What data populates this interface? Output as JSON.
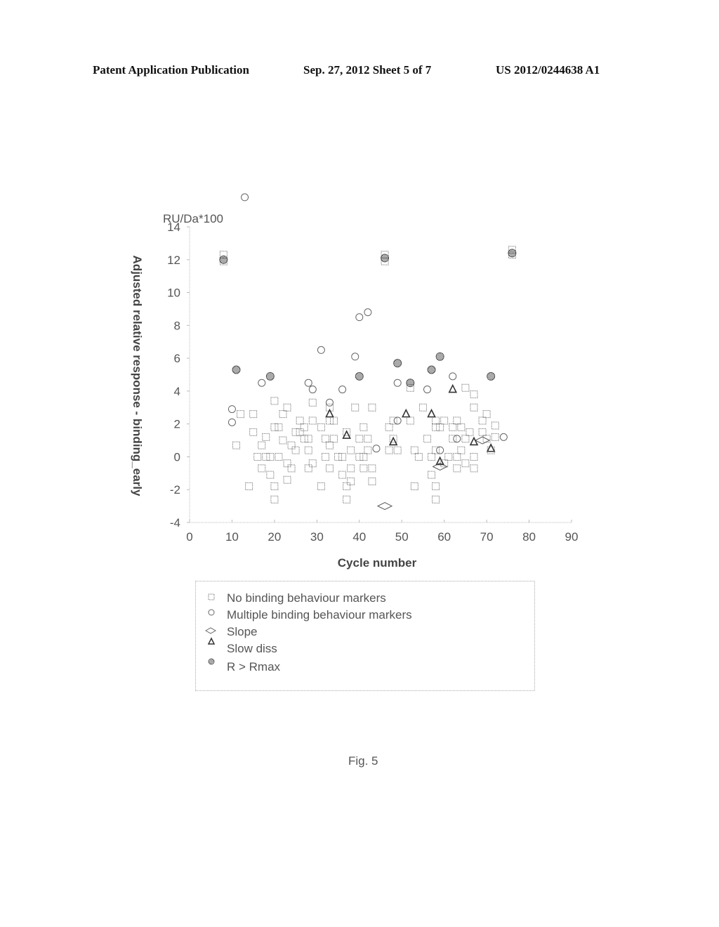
{
  "header": {
    "left": "Patent Application Publication",
    "middle": "Sep. 27, 2012   Sheet 5 of 7",
    "right": "US 2012/0244638 A1"
  },
  "figure_caption": "Fig. 5",
  "chart_data": {
    "type": "scatter",
    "title": "",
    "xlabel": "Cycle number",
    "ylabel": "Adjusted relative response - binding_early",
    "y_unit_label": "RU/Da*100",
    "xlim": [
      0,
      90
    ],
    "ylim": [
      -4,
      14
    ],
    "x_ticks": [
      0,
      10,
      20,
      30,
      40,
      50,
      60,
      70,
      80,
      90
    ],
    "y_ticks": [
      -4,
      -2,
      0,
      2,
      4,
      6,
      8,
      10,
      12,
      14
    ],
    "grid": false,
    "legend_position": "bottom",
    "series": [
      {
        "name": "No binding behaviour markers",
        "marker": "square",
        "points": [
          [
            8,
            12.3
          ],
          [
            8,
            11.9
          ],
          [
            11,
            0.7
          ],
          [
            12,
            2.6
          ],
          [
            14,
            -1.8
          ],
          [
            15,
            2.6
          ],
          [
            15,
            1.5
          ],
          [
            16,
            0
          ],
          [
            17,
            0.7
          ],
          [
            17,
            -0.7
          ],
          [
            18,
            1.2
          ],
          [
            18,
            0
          ],
          [
            19,
            0
          ],
          [
            19,
            -1.1
          ],
          [
            20,
            3.4
          ],
          [
            20,
            1.8
          ],
          [
            20,
            -1.8
          ],
          [
            20,
            -2.6
          ],
          [
            21,
            1.8
          ],
          [
            21,
            0
          ],
          [
            22,
            2.6
          ],
          [
            22,
            1
          ],
          [
            23,
            3
          ],
          [
            23,
            -0.4
          ],
          [
            23,
            -1.4
          ],
          [
            24,
            0.7
          ],
          [
            24,
            -0.7
          ],
          [
            25,
            1.5
          ],
          [
            25,
            0.4
          ],
          [
            26,
            2.2
          ],
          [
            26,
            1.5
          ],
          [
            27,
            1.8
          ],
          [
            27,
            1.1
          ],
          [
            28,
            1.1
          ],
          [
            28,
            0.4
          ],
          [
            28,
            -0.7
          ],
          [
            29,
            3.3
          ],
          [
            29,
            2.2
          ],
          [
            29,
            -0.4
          ],
          [
            31,
            1.8
          ],
          [
            31,
            -1.8
          ],
          [
            32,
            1.1
          ],
          [
            32,
            0
          ],
          [
            33,
            3
          ],
          [
            33,
            2.2
          ],
          [
            33,
            0.7
          ],
          [
            33,
            -0.7
          ],
          [
            34,
            2.2
          ],
          [
            34,
            1.1
          ],
          [
            35,
            0
          ],
          [
            36,
            0
          ],
          [
            36,
            -1.1
          ],
          [
            37,
            1.5
          ],
          [
            37,
            -1.8
          ],
          [
            37,
            -2.6
          ],
          [
            38,
            0.4
          ],
          [
            38,
            -0.7
          ],
          [
            38,
            -1.5
          ],
          [
            39,
            3
          ],
          [
            40,
            1.1
          ],
          [
            40,
            0
          ],
          [
            41,
            1.8
          ],
          [
            41,
            0
          ],
          [
            41,
            -0.7
          ],
          [
            42,
            1.1
          ],
          [
            42,
            0.4
          ],
          [
            43,
            3
          ],
          [
            43,
            -0.7
          ],
          [
            43,
            -1.5
          ],
          [
            46,
            12.3
          ],
          [
            46,
            11.9
          ],
          [
            47,
            1.8
          ],
          [
            47,
            0.4
          ],
          [
            48,
            2.2
          ],
          [
            48,
            1.1
          ],
          [
            49,
            0.4
          ],
          [
            52,
            2.2
          ],
          [
            52,
            4.2
          ],
          [
            53,
            -1.8
          ],
          [
            53,
            0.4
          ],
          [
            54,
            0
          ],
          [
            55,
            3
          ],
          [
            56,
            1.1
          ],
          [
            57,
            0
          ],
          [
            57,
            -1.1
          ],
          [
            58,
            2.2
          ],
          [
            58,
            1.8
          ],
          [
            58,
            0.4
          ],
          [
            58,
            -1.8
          ],
          [
            58,
            -2.6
          ],
          [
            59,
            1.8
          ],
          [
            60,
            2.2
          ],
          [
            60,
            -0.4
          ],
          [
            61,
            0
          ],
          [
            62,
            1.8
          ],
          [
            62,
            1.1
          ],
          [
            63,
            2.2
          ],
          [
            63,
            0
          ],
          [
            63,
            -0.7
          ],
          [
            64,
            1.8
          ],
          [
            64,
            0.4
          ],
          [
            65,
            4.2
          ],
          [
            65,
            1.1
          ],
          [
            65,
            -0.4
          ],
          [
            66,
            1.5
          ],
          [
            67,
            3.8
          ],
          [
            67,
            3
          ],
          [
            67,
            0
          ],
          [
            67,
            -0.7
          ],
          [
            69,
            1.5
          ],
          [
            69,
            2.2
          ],
          [
            70,
            2.6
          ],
          [
            70,
            1.1
          ],
          [
            71,
            0.4
          ],
          [
            72,
            1.9
          ],
          [
            72,
            1.2
          ],
          [
            76,
            12.6
          ],
          [
            76,
            12.3
          ]
        ]
      },
      {
        "name": "Multiple binding behaviour markers",
        "marker": "circle",
        "points": [
          [
            13,
            15.8
          ],
          [
            10,
            2.9
          ],
          [
            10,
            2.1
          ],
          [
            17,
            4.5
          ],
          [
            28,
            4.5
          ],
          [
            29,
            4.1
          ],
          [
            31,
            6.5
          ],
          [
            33,
            3.3
          ],
          [
            36,
            4.1
          ],
          [
            39,
            6.1
          ],
          [
            40,
            8.5
          ],
          [
            42,
            8.8
          ],
          [
            44,
            0.5
          ],
          [
            49,
            4.5
          ],
          [
            49,
            2.2
          ],
          [
            56,
            4.1
          ],
          [
            59,
            0.4
          ],
          [
            62,
            4.9
          ],
          [
            63,
            1.1
          ],
          [
            74,
            1.2
          ]
        ]
      },
      {
        "name": "Slope",
        "marker": "diamond",
        "points": [
          [
            46,
            -3
          ],
          [
            59,
            -0.6
          ],
          [
            69,
            1
          ]
        ]
      },
      {
        "name": "Slow diss",
        "marker": "triangle",
        "points": [
          [
            33,
            2.6
          ],
          [
            37,
            1.3
          ],
          [
            48,
            0.9
          ],
          [
            51,
            2.6
          ],
          [
            57,
            2.6
          ],
          [
            59,
            -0.3
          ],
          [
            62,
            4.1
          ],
          [
            67,
            0.9
          ],
          [
            71,
            0.5
          ]
        ]
      },
      {
        "name": "R > Rmax",
        "marker": "filled-circle",
        "points": [
          [
            8,
            12.0
          ],
          [
            11,
            5.3
          ],
          [
            19,
            4.9
          ],
          [
            40,
            4.9
          ],
          [
            46,
            12.1
          ],
          [
            49,
            5.7
          ],
          [
            52,
            4.5
          ],
          [
            57,
            5.3
          ],
          [
            59,
            6.1
          ],
          [
            71,
            4.9
          ],
          [
            76,
            12.4
          ]
        ]
      }
    ]
  }
}
